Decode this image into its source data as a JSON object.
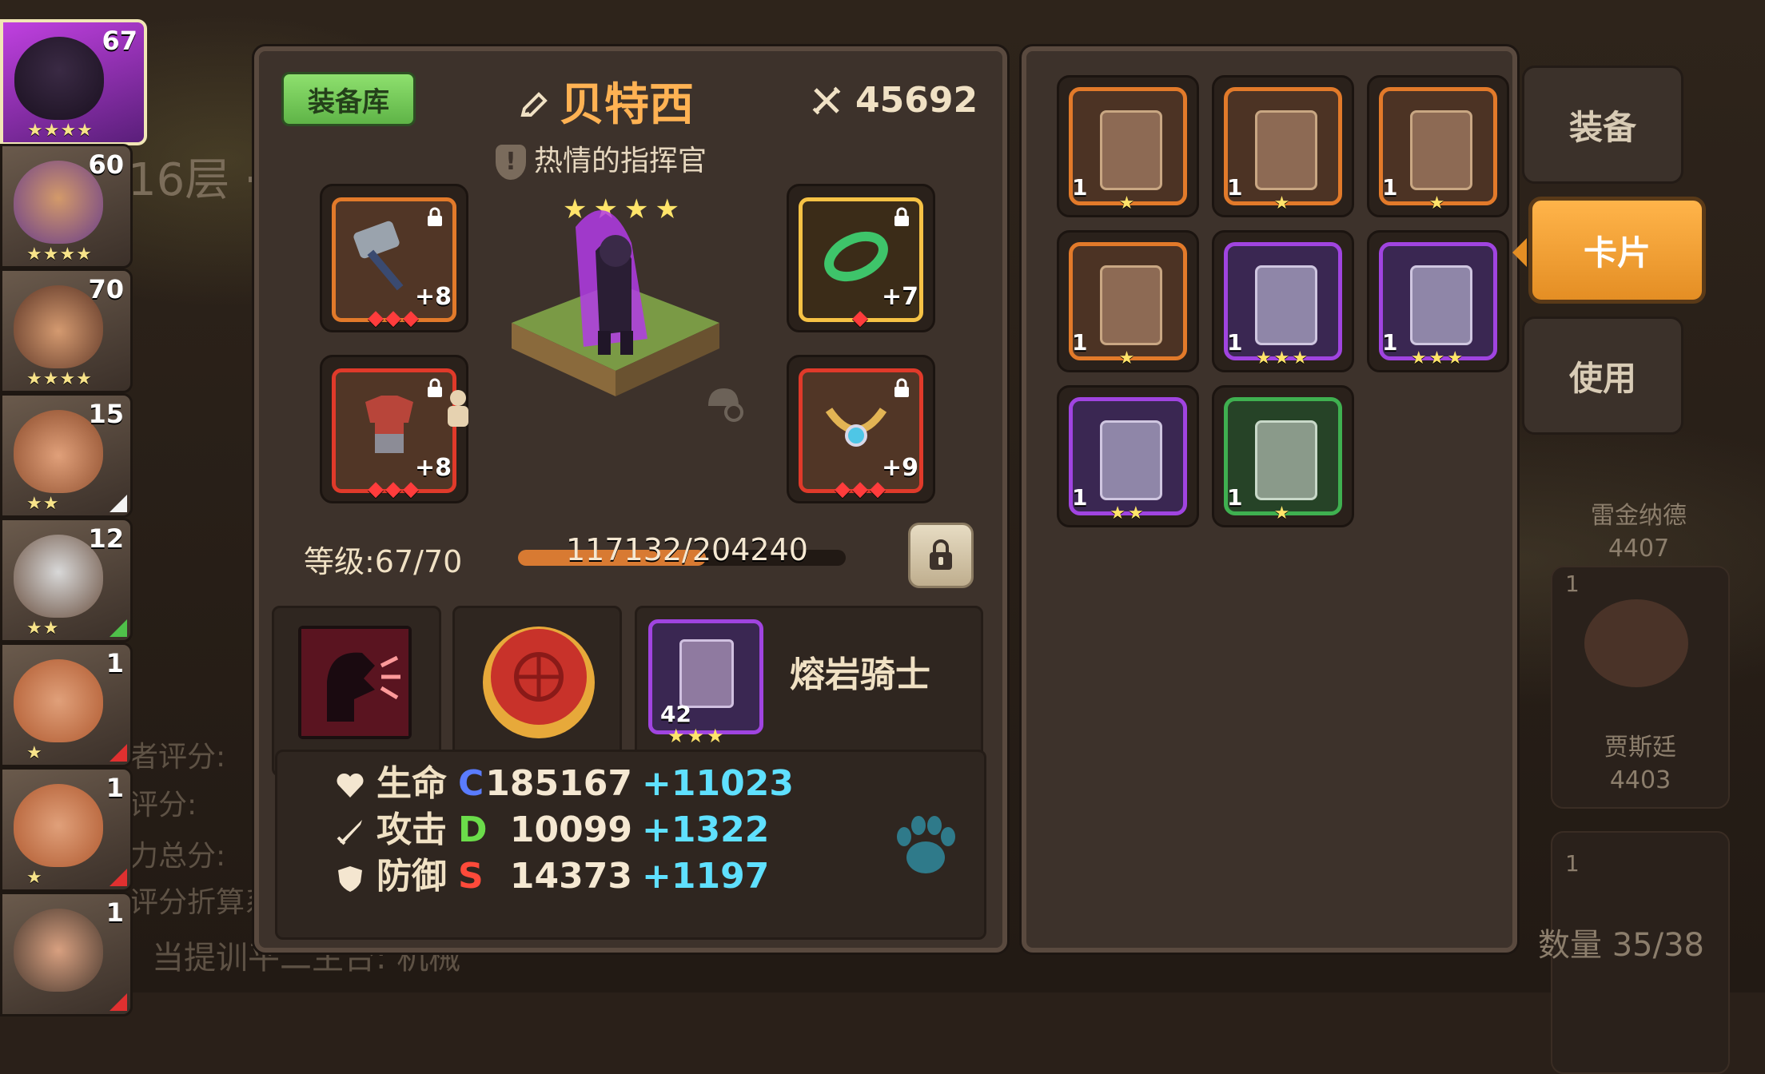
{
  "left_list": {
    "heroes": [
      {
        "level": "67",
        "stars": "★★★★"
      },
      {
        "level": "60",
        "stars": "★★★★"
      },
      {
        "level": "70",
        "stars": "★★★★"
      },
      {
        "level": "15",
        "stars": "★★"
      },
      {
        "level": "12",
        "stars": "★★"
      },
      {
        "level": "1",
        "stars": "★"
      },
      {
        "level": "1",
        "stars": "★"
      },
      {
        "level": "1",
        "stars": ""
      }
    ]
  },
  "background": {
    "floor_text": "16层 ·",
    "ghost_lines": [
      "者评分:",
      "评分:",
      "力总分:",
      "评分折算系"
    ],
    "bottom_hint": "当提训平二主台: 机械",
    "right_cards": [
      {
        "name": "雷金纳德",
        "number": "4407",
        "level": ""
      },
      {
        "name": "贾斯廷",
        "number": "4403",
        "level": "1"
      },
      {
        "name": "",
        "number": "",
        "level": "1"
      }
    ]
  },
  "detail": {
    "library_button": "装备库",
    "hero_name": "贝特西",
    "power": "45692",
    "title": "热情的指挥官",
    "hero_stars": "★★★★",
    "slots": [
      {
        "plus": "+8",
        "gems": "◆◆◆",
        "item": "hammer-icon"
      },
      {
        "plus": "+7",
        "gems": "◆",
        "item": "jade-bracelet-icon"
      },
      {
        "plus": "+8",
        "gems": "◆◆◆",
        "item": "armor-icon"
      },
      {
        "plus": "+9",
        "gems": "◆◆◆",
        "item": "necklace-icon"
      }
    ],
    "level_label": "等级:67/70",
    "xp_text": "117132/204240",
    "xp_progress": 0.573,
    "skill_card": {
      "level": "42",
      "stars": "★★★",
      "name": "熔岩骑士"
    },
    "stats": [
      {
        "label": "生命",
        "grade": "C",
        "grade_color": "#5a7cff",
        "value": "185167",
        "bonus": "+11023"
      },
      {
        "label": "攻击",
        "grade": "D",
        "grade_color": "#6bdc4a",
        "value": "10099",
        "bonus": "+1322"
      },
      {
        "label": "防御",
        "grade": "S",
        "grade_color": "#ff4a3a",
        "value": "14373",
        "bonus": "+1197"
      }
    ]
  },
  "inventory": {
    "cards": [
      {
        "count": "1",
        "stars": "★",
        "rarity": "orange",
        "icon": "lion-card"
      },
      {
        "count": "1",
        "stars": "★",
        "rarity": "orange",
        "icon": "griffin-card"
      },
      {
        "count": "1",
        "stars": "★",
        "rarity": "orange",
        "icon": "golem-card"
      },
      {
        "count": "1",
        "stars": "★",
        "rarity": "orange",
        "icon": "dragon-card"
      },
      {
        "count": "1",
        "stars": "★★★",
        "rarity": "purple",
        "icon": "goblin-card"
      },
      {
        "count": "1",
        "stars": "★★★",
        "rarity": "purple",
        "icon": "goblin-card"
      },
      {
        "count": "1",
        "stars": "★★",
        "rarity": "purple",
        "icon": "goblin-card"
      },
      {
        "count": "1",
        "stars": "★",
        "rarity": "green",
        "icon": "boar-card"
      }
    ],
    "count_label": "数量 35/38"
  },
  "tabs": {
    "equipment": "装备",
    "cards": "卡片",
    "use": "使用"
  },
  "colors": {
    "accent": "#e48e24",
    "name": "#ffb253",
    "bonus": "#5fe0ff",
    "panel": "#3d322b"
  }
}
